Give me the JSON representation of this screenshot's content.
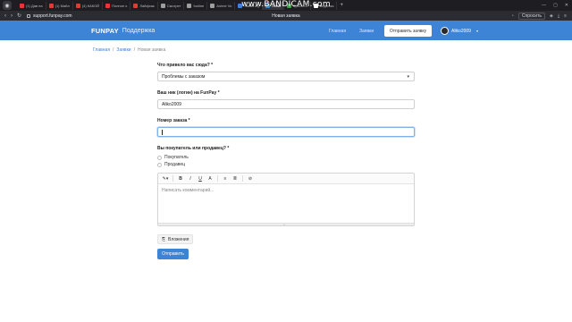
{
  "browser": {
    "tabs": [
      {
        "label": "(1) Дав на",
        "color": "#e53935",
        "active": false
      },
      {
        "label": "(1) Майл",
        "color": "#e53935",
        "active": false
      },
      {
        "label": "(4) КАКОЙ",
        "color": "#e53935",
        "active": false
      },
      {
        "label": "Полное о",
        "color": "#e53935",
        "active": false
      },
      {
        "label": "Лайфхак",
        "color": "#e53935",
        "active": false
      },
      {
        "label": "Смотрет",
        "color": "#9e9e9e",
        "active": false
      },
      {
        "label": "funline",
        "color": "#9e9e9e",
        "active": false
      },
      {
        "label": "Anime Vo",
        "color": "#9e9e9e",
        "active": false
      },
      {
        "label": "Заказ #Q",
        "color": "#3d83d6",
        "active": false
      },
      {
        "label": "Нова",
        "color": "#3d83d6",
        "active": true
      },
      {
        "label": "Купить а",
        "color": "#43a047",
        "active": false
      },
      {
        "label": "Видеоза",
        "color": "#ffffff",
        "active": false
      }
    ],
    "url": "support.funpay.com",
    "page_title": "Новая заявка",
    "ask_label": "Спросить",
    "watermark": "www.BANDICAM.com"
  },
  "header": {
    "logo": "FUNPAY",
    "logo_sub": "Поддержка",
    "nav": [
      "Главная",
      "Заявки"
    ],
    "submit_ticket": "Отправить заявку",
    "user": "Aliko2009"
  },
  "breadcrumb": [
    "Главная",
    "Заявки",
    "Новая заявка"
  ],
  "form": {
    "reason_label": "Что привело вас сюда? *",
    "reason_value": "Проблемы с заказом",
    "nick_label": "Ваш ник (логин) на FunPay *",
    "nick_value": "Aliko2009",
    "order_label": "Номер заказа *",
    "order_value": "",
    "role_label": "Вы покупатель или продавец? *",
    "role_options": [
      "Покупатель",
      "Продавец"
    ],
    "editor_placeholder": "Написать комментарий...",
    "toolbar": [
      "✎▾",
      "B",
      "I",
      "U",
      "A",
      "≡",
      "≣",
      "⊘"
    ],
    "attach_label": "Вложения",
    "submit_label": "Отправить"
  }
}
